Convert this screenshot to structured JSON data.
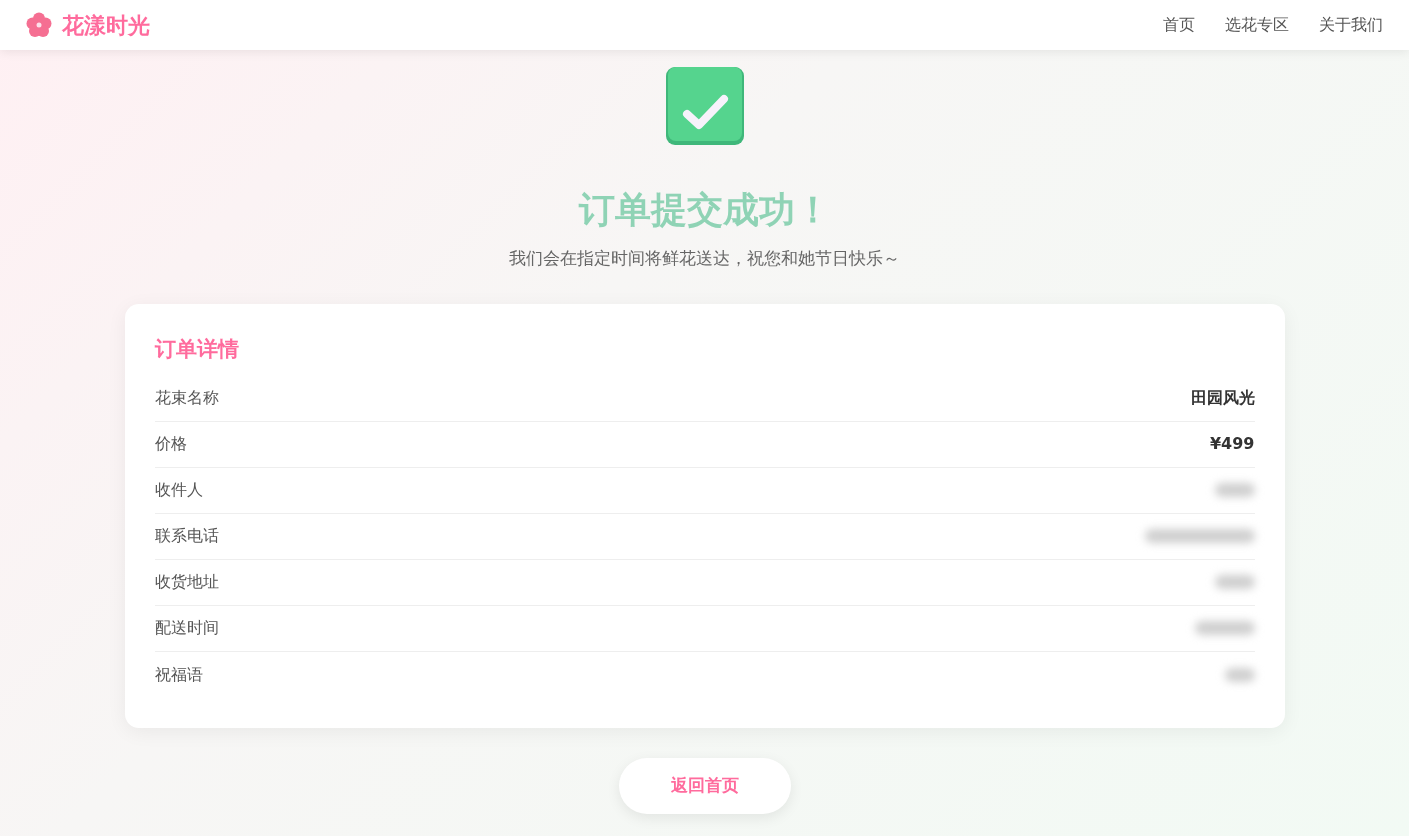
{
  "brand": {
    "name": "花漾时光"
  },
  "nav": [
    {
      "label": "首页"
    },
    {
      "label": "选花专区"
    },
    {
      "label": "关于我们"
    }
  ],
  "title": "订单提交成功！",
  "subtitle": "我们会在指定时间将鲜花送达，祝您和她节日快乐～",
  "order": {
    "title": "订单详情",
    "rows": [
      {
        "label": "花束名称",
        "kind": "text",
        "value": "田园风光"
      },
      {
        "label": "价格",
        "kind": "text",
        "value": "¥499"
      },
      {
        "label": "收件人",
        "kind": "redacted"
      },
      {
        "label": "联系电话",
        "kind": "redacted"
      },
      {
        "label": "收货地址",
        "kind": "redacted"
      },
      {
        "label": "配送时间",
        "kind": "redacted"
      },
      {
        "label": "祝福语",
        "kind": "redacted"
      }
    ]
  },
  "button": "返回首页"
}
